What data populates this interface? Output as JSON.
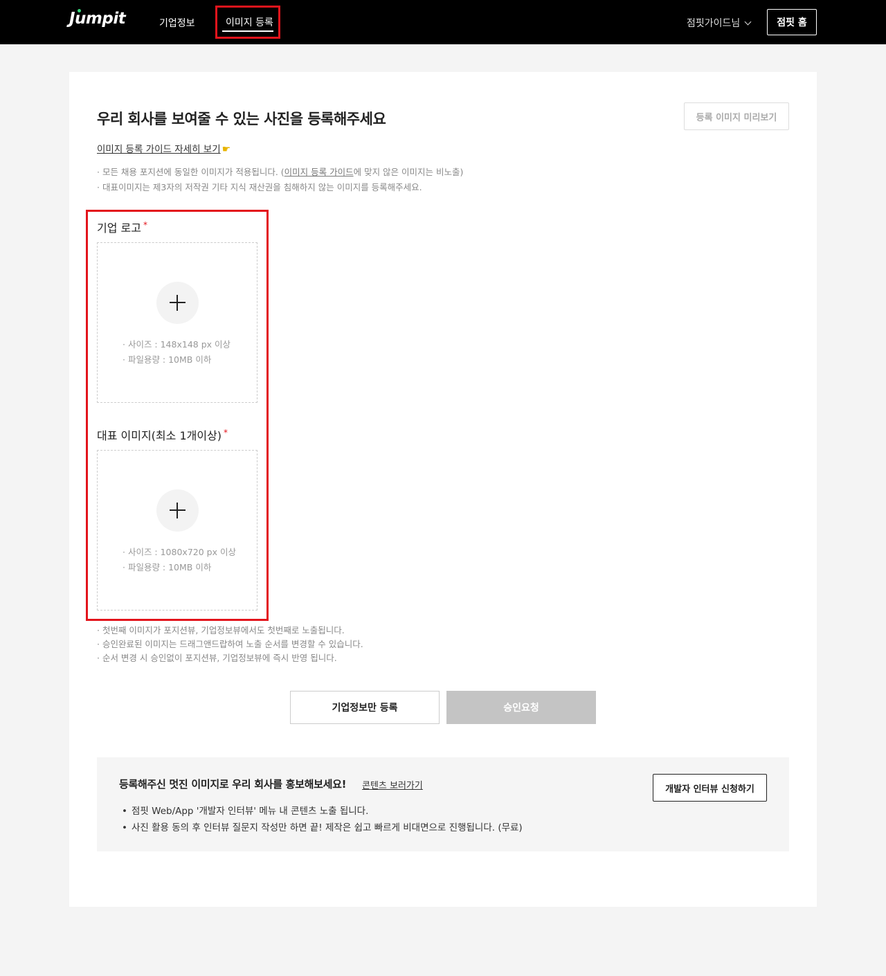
{
  "header": {
    "logo": "Jumpit",
    "nav": {
      "company_info": "기업정보",
      "image_register": "이미지 등록"
    },
    "user_menu": "점핏가이드님",
    "home_button": "점핏 홈"
  },
  "main": {
    "title": "우리 회사를 보여줄 수 있는 사진을 등록해주세요",
    "preview_button": "등록 이미지 미리보기",
    "guide_link": "이미지 등록 가이드 자세히 보기",
    "notices": {
      "line1_prefix": "· 모든 채용 포지션에 동일한 이미지가 적용됩니다. (",
      "line1_link": "이미지 등록 가이드",
      "line1_suffix": "에 맞지 않은 이미지는 비노출)",
      "line2": "· 대표이미지는 제3자의 저작권 기타 지식 재산권을 침해하지 않는 이미지를 등록해주세요."
    },
    "logo_section": {
      "label": "기업 로고",
      "required_mark": "*",
      "spec_size": "· 사이즈 : 148x148 px 이상",
      "spec_file": "· 파일용량 : 10MB 이하"
    },
    "main_image_section": {
      "label": "대표 이미지(최소 1개이상)",
      "required_mark": "*",
      "spec_size": "· 사이즈 : 1080x720 px 이상",
      "spec_file": "· 파일용량 : 10MB 이하"
    },
    "image_notes": [
      "· 첫번째 이미지가 포지션뷰, 기업정보뷰에서도 첫번째로 노출됩니다.",
      "· 승인완료된 이미지는 드래그앤드랍하여 노출 순서를 변경할 수 있습니다.",
      "· 순서 변경 시 승인없이 포지션뷰, 기업정보뷰에 즉시 반영 됩니다."
    ],
    "buttons": {
      "register_company_only": "기업정보만 등록",
      "request_approval": "승인요청"
    },
    "promo": {
      "title": "등록해주신 멋진 이미지로 우리 회사를 홍보해보세요!",
      "link": "콘텐츠 보러가기",
      "items": [
        "점핏 Web/App '개발자 인터뷰' 메뉴 내 콘텐츠 노출 됩니다.",
        "사진 활용 동의 후 인터뷰 질문지 작성만 하면 끝! 제작은 쉽고 빠르게 비대면으로 진행됩니다. (무료)"
      ],
      "button": "개발자 인터뷰 신청하기"
    }
  }
}
